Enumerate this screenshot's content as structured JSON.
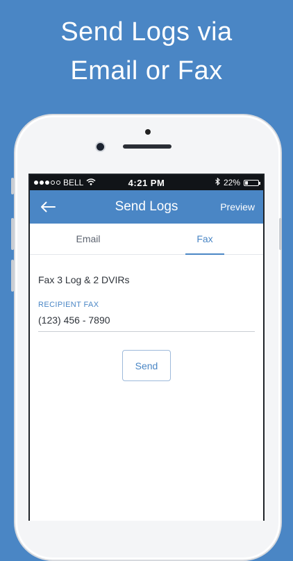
{
  "promo": {
    "line1": "Send Logs via",
    "line2": "Email or Fax"
  },
  "status_bar": {
    "carrier": "BELL",
    "time": "4:21 PM",
    "battery": "22%",
    "battery_level": 0.22,
    "icons": [
      "signal-dots-icon",
      "wifi-icon",
      "bluetooth-icon",
      "battery-icon"
    ]
  },
  "nav": {
    "back_icon": "back-arrow-icon",
    "title": "Send Logs",
    "preview_label": "Preview"
  },
  "tabs": [
    {
      "label": "Email",
      "active": false
    },
    {
      "label": "Fax",
      "active": true
    }
  ],
  "form": {
    "summary": "Fax 3 Log & 2 DVIRs",
    "recipient_label": "RECIPIENT FAX",
    "recipient_value": "(123) 456 - 7890",
    "send_label": "Send"
  },
  "colors": {
    "accent": "#4a86c5",
    "background": "#4a86c5",
    "text": "#2e333a"
  }
}
